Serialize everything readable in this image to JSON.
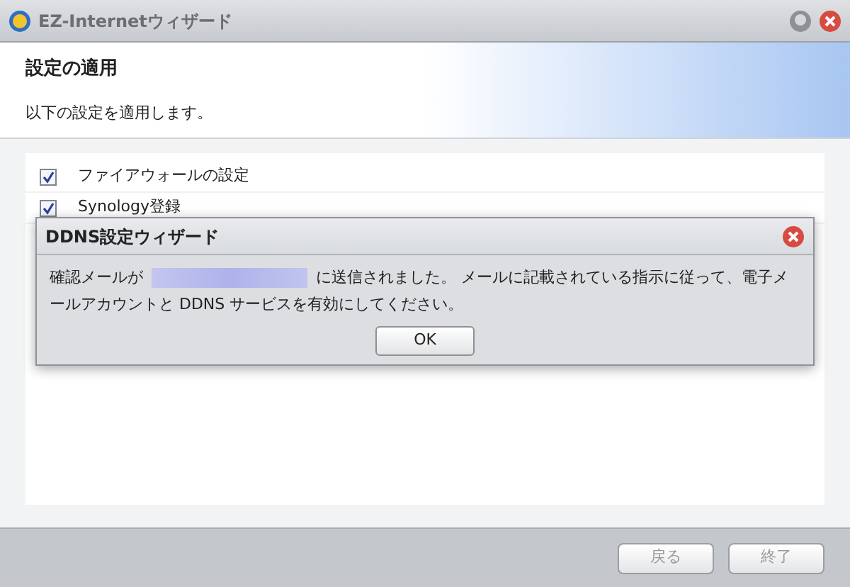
{
  "window": {
    "title": "EZ-Internetウィザード"
  },
  "header": {
    "title": "設定の適用",
    "subtitle": "以下の設定を適用します。"
  },
  "settings": [
    {
      "label": "ファイアウォールの設定",
      "checked": true
    },
    {
      "label": "Synology登録",
      "checked": true
    }
  ],
  "dialog": {
    "title": "DDNS設定ウィザード",
    "message_before": "確認メールが",
    "message_after": "に送信されました。 メールに記載されている指示に従って、電子メールアカウントと DDNS サービスを有効にしてください。",
    "ok": "OK"
  },
  "footer": {
    "buttons": [
      {
        "label": "戻る",
        "disabled": true
      },
      {
        "label": "終了",
        "disabled": true
      }
    ]
  }
}
